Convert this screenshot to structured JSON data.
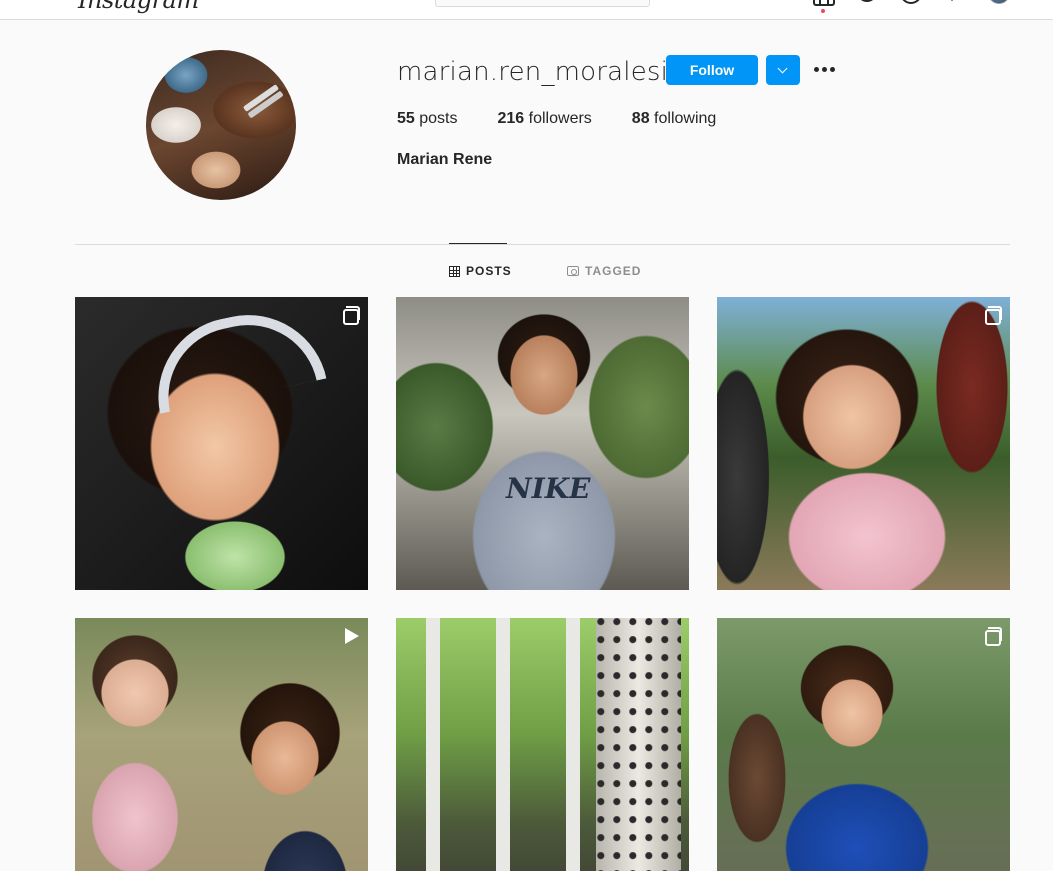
{
  "nav": {
    "logo_text": "Instagram",
    "icons": [
      "home-icon",
      "messenger-icon",
      "explore-icon",
      "heart-icon",
      "profile-avatar"
    ],
    "notification_color": "#ed4956"
  },
  "profile": {
    "username": "marian.ren_moralesih",
    "follow_label": "Follow",
    "stats": {
      "posts_count": "55",
      "posts_label": "posts",
      "followers_count": "216",
      "followers_label": "followers",
      "following_count": "88",
      "following_label": "following"
    },
    "full_name": "Marian Rene"
  },
  "tabs": [
    {
      "label": "POSTS",
      "icon": "grid-icon",
      "active": true
    },
    {
      "label": "TAGGED",
      "icon": "tag-icon",
      "active": false
    }
  ],
  "posts": [
    {
      "type": "carousel",
      "description": "toddler girl with headband"
    },
    {
      "type": "photo",
      "description": "boy in grey hoodie"
    },
    {
      "type": "carousel",
      "description": "toddler girl in pink jacket"
    },
    {
      "type": "video",
      "description": "two children with dandelion"
    },
    {
      "type": "carousel",
      "description": "aspen tree trunks"
    },
    {
      "type": "carousel",
      "description": "boy in blue shirt"
    }
  ],
  "colors": {
    "accent": "#0095f6",
    "text": "#262626",
    "muted": "#8e8e8e",
    "background": "#fafafa",
    "border": "#dbdbdb"
  }
}
